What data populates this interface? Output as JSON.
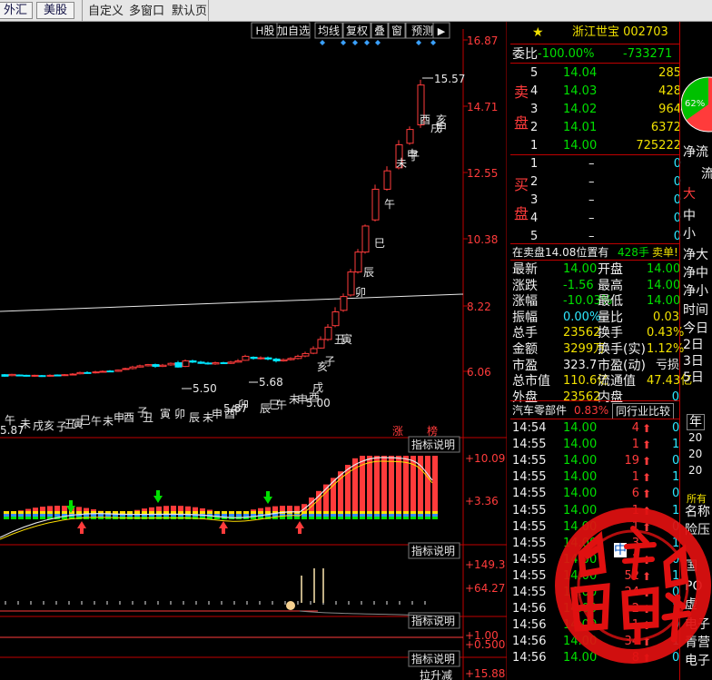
{
  "toolbar": {
    "forex": "外汇",
    "us_stock": "美股",
    "custom": "自定义",
    "multi_window": "多窗口",
    "default_page": "默认页"
  },
  "chart_toolbar": [
    "H股",
    "加自选",
    "均线",
    "复权",
    "叠",
    "窗",
    "预测"
  ],
  "price_axis": [
    "16.87",
    "14.71",
    "12.55",
    "10.38",
    "8.22",
    "6.06"
  ],
  "indicator_axis": {
    "ind1": [
      "+10.09",
      "+3.36"
    ],
    "ind2": [
      "+149.3",
      "+64.27"
    ],
    "ind3": [
      "+1.00",
      "+0.500"
    ],
    "ind4": [
      "+15.88"
    ]
  },
  "indicator_btn": "指标说明",
  "chart_labels": {
    "high": "15.57",
    "p550": "5.50",
    "p568": "5.68",
    "p500": "5.00",
    "p587": "5.87",
    "lbl_zhang": "涨",
    "lbl_bang": "榜",
    "lbl_bottom": "拉升减"
  },
  "candle_labels": [
    "午",
    "未",
    "戌",
    "亥",
    "子",
    "丑",
    "寅",
    "巳",
    "午",
    "未",
    "申",
    "酉",
    "子",
    "丑",
    "寅",
    "卯",
    "辰",
    "未",
    "申",
    "酉",
    "午",
    "卯",
    "辰",
    "巳",
    "午",
    "未",
    "申",
    "酉",
    "戌",
    "亥",
    "子",
    "丑",
    "寅",
    "卯",
    "辰",
    "巳",
    "午",
    "未",
    "申",
    "酉",
    "戌",
    "亥",
    "子",
    "申"
  ],
  "stock": {
    "name": "浙江世宝",
    "code": "002703",
    "star": "★"
  },
  "weibi": {
    "label": "委比",
    "pct": "-100.00%",
    "diff": "-733271"
  },
  "sell_label": "卖盘",
  "buy_label": "买盘",
  "sell": [
    {
      "n": "5",
      "p": "14.04",
      "v": "285"
    },
    {
      "n": "4",
      "p": "14.03",
      "v": "428"
    },
    {
      "n": "3",
      "p": "14.02",
      "v": "964"
    },
    {
      "n": "2",
      "p": "14.01",
      "v": "6372"
    },
    {
      "n": "1",
      "p": "14.00",
      "v": "725222"
    }
  ],
  "buy": [
    {
      "n": "1",
      "p": "–",
      "v": "0"
    },
    {
      "n": "2",
      "p": "–",
      "v": "0"
    },
    {
      "n": "3",
      "p": "–",
      "v": "0"
    },
    {
      "n": "4",
      "p": "–",
      "v": "0"
    },
    {
      "n": "5",
      "p": "–",
      "v": "0"
    }
  ],
  "sell_note": {
    "text": "在卖盘14.08位置有",
    "qty": "428手",
    "tag": "卖单!"
  },
  "quote": [
    {
      "l": "最新",
      "v": "14.00",
      "l2": "开盘",
      "v2": "14.00"
    },
    {
      "l": "涨跌",
      "v": "-1.56",
      "l2": "最高",
      "v2": "14.00"
    },
    {
      "l": "涨幅",
      "v": "-10.03%",
      "l2": "最低",
      "v2": "14.00"
    },
    {
      "l": "振幅",
      "v": "0.00%",
      "l2": "量比",
      "v2": "0.03"
    },
    {
      "l": "总手",
      "v": "23562",
      "l2": "换手",
      "v2": "0.43%"
    },
    {
      "l": "金额",
      "v": "3299万",
      "l2": "换手(实)",
      "v2": "1.12%"
    },
    {
      "l": "市盈",
      "v": "323.7",
      "l2": "市盈(动)",
      "v2": "亏损"
    },
    {
      "l": "总市值",
      "v": "110.6亿",
      "l2": "流通值",
      "v2": "47.43亿"
    },
    {
      "l": "外盘",
      "v": "23562",
      "l2": "内盘",
      "v2": "0"
    }
  ],
  "sector": {
    "name": "汽车零部件",
    "pct": "0.83%",
    "btn": "同行业比较"
  },
  "ticks": [
    {
      "t": "14:54",
      "p": "14.00",
      "v": "4"
    },
    {
      "t": "14:55",
      "p": "14.00",
      "v": "1"
    },
    {
      "t": "14:55",
      "p": "14.00",
      "v": "19"
    },
    {
      "t": "14:55",
      "p": "14.00",
      "v": "1"
    },
    {
      "t": "14:55",
      "p": "14.00",
      "v": "6"
    },
    {
      "t": "14:55",
      "p": "14.00",
      "v": "1"
    },
    {
      "t": "14:55",
      "p": "14.00",
      "v": "1"
    },
    {
      "t": "14:55",
      "p": "14.00",
      "v": "3"
    },
    {
      "t": "14:55",
      "p": "14.00",
      "v": "1"
    },
    {
      "t": "14:55",
      "p": "14.00",
      "v": "52"
    },
    {
      "t": "14:55",
      "p": "14.00",
      "v": "24"
    },
    {
      "t": "14:56",
      "p": "14.00",
      "v": "2"
    },
    {
      "t": "14:56",
      "p": "14.00",
      "v": "1"
    },
    {
      "t": "14:56",
      "p": "14.00",
      "v": "34"
    },
    {
      "t": "14:56",
      "p": "14.00",
      "v": "8"
    }
  ],
  "edge": {
    "pct": "62%",
    "net_liu": "净流",
    "liu": "流",
    "da": "大",
    "zhong": "中",
    "xiao": "小",
    "jing_da": "净大",
    "jing_zhong": "净中",
    "jing_xiao": "净小",
    "shijian": "时间",
    "jinri": "今日",
    "d2": "2日",
    "d3": "3日",
    "d5": "5日",
    "nian": "年",
    "r20a": "20",
    "r20b": "20",
    "r20c": "20",
    "suoyou": "所有",
    "mingcheng": "名称",
    "ya": "险压",
    "guo": "国",
    "po": "PO",
    "xu": "虚",
    "dianzi": "电子",
    "qing": "青营",
    "dianz2": "电子",
    "zhong2": "中"
  },
  "colors": {
    "up": "#ff3b3b",
    "down": "#00e5ff",
    "axis": "#c00000"
  }
}
